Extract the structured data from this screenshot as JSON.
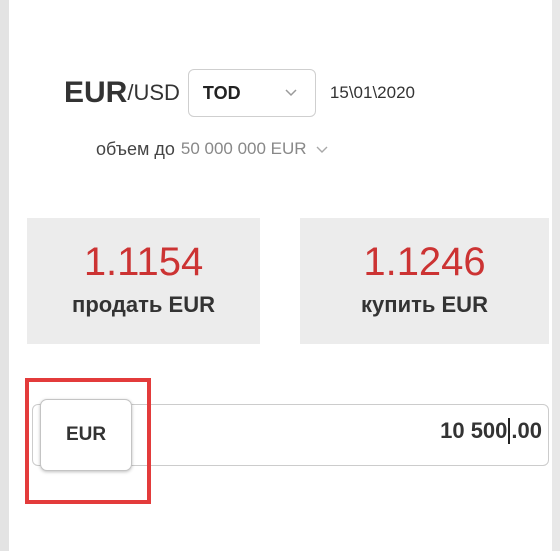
{
  "pair": {
    "base": "EUR",
    "quote": "/USD",
    "tenor": "TOD",
    "date": "15\\01\\2020"
  },
  "volume": {
    "label": "объем до",
    "value": "50 000 000 EUR"
  },
  "prices": {
    "sell": {
      "rate": "1.1154",
      "action": "продать EUR"
    },
    "buy": {
      "rate": "1.1246",
      "action": "купить EUR"
    }
  },
  "amount": {
    "currency": "EUR",
    "integer_part": "10 500",
    "fraction_part": ".00"
  },
  "icons": {
    "tenor_chevron": "chevron-down-icon",
    "volume_chevron": "chevron-down-icon"
  },
  "colors": {
    "rate": "#cc3333",
    "price_box_bg": "#ececec",
    "highlight": "#e33b3b"
  }
}
